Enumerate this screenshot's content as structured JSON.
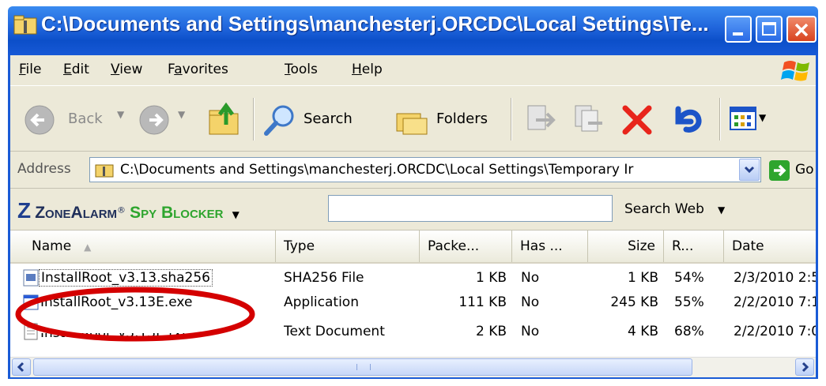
{
  "window": {
    "title": "C:\\Documents and Settings\\manchesterj.ORCDC\\Local Settings\\Te...",
    "colors": {
      "titlebar": "#0c4fc9",
      "frame": "#ece9d8",
      "annotation": "#d40000"
    }
  },
  "menu": [
    "File",
    "Edit",
    "View",
    "Favorites",
    "Tools",
    "Help"
  ],
  "menu_accel": [
    "F",
    "E",
    "V",
    "a",
    "T",
    "H"
  ],
  "toolbar": {
    "back_label": "Back",
    "search_label": "Search",
    "folders_label": "Folders"
  },
  "address": {
    "label": "Address",
    "value": "C:\\Documents and Settings\\manchesterj.ORCDC\\Local Settings\\Temporary Ir",
    "go_label": "Go"
  },
  "zonealarm": {
    "brand_1": "ZoneAlarm",
    "brand_mark": "®",
    "brand_2": "Spy Blocker",
    "search_label": "Search Web",
    "search_value": ""
  },
  "columns": [
    "Name",
    "Type",
    "Packe...",
    "Has ...",
    "Size",
    "R...",
    "Date"
  ],
  "files": [
    {
      "name": "InstallRoot_v3.13.sha256",
      "type": "SHA256 File",
      "packed": "1 KB",
      "has": "No",
      "size": "1 KB",
      "ratio": "54%",
      "date": "2/3/2010 2:5"
    },
    {
      "name": "InstallRoot_v3.13E.exe",
      "type": "Application",
      "packed": "111 KB",
      "has": "No",
      "size": "245 KB",
      "ratio": "55%",
      "date": "2/2/2010 7:1"
    },
    {
      "name": "InstallRoot_v3.13E.txt",
      "type": "Text Document",
      "packed": "2 KB",
      "has": "No",
      "size": "4 KB",
      "ratio": "68%",
      "date": "2/2/2010 7:0"
    }
  ]
}
